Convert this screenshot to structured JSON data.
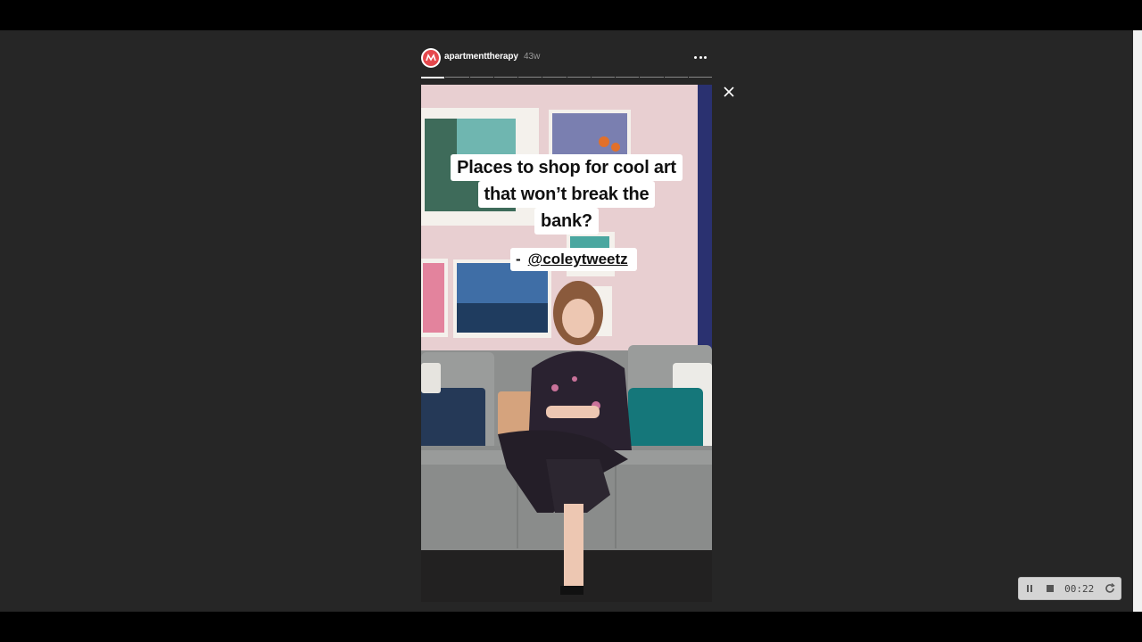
{
  "story": {
    "username": "apartmenttherapy",
    "timestamp": "43w",
    "caption_lines": [
      "Places to shop for cool art",
      "that won’t break the",
      "bank?"
    ],
    "mention_dash": "-",
    "mention_handle": "@coleytweetz",
    "progress_segments": 12,
    "progress_completed": 1
  },
  "player": {
    "time": "00:22"
  },
  "icons": {
    "more": "more-options-icon",
    "close": "close-icon",
    "pause": "pause-icon",
    "stop": "stop-icon",
    "replay": "replay-icon",
    "avatar": "apartmenttherapy-logo"
  },
  "colors": {
    "background": "#262626",
    "caption_bg": "#ffffff",
    "brand": "#e5484d"
  }
}
